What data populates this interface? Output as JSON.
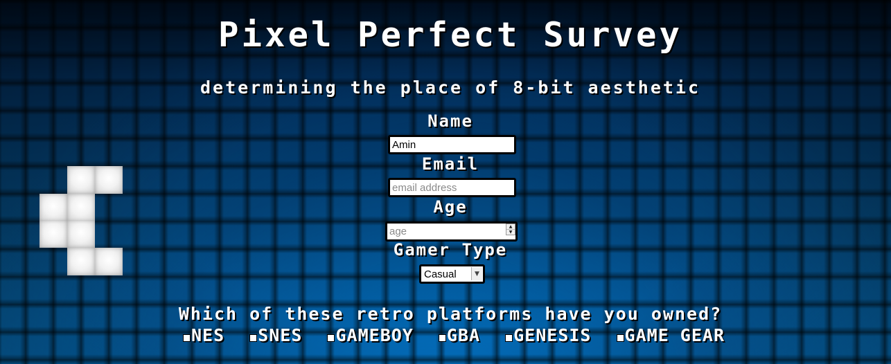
{
  "header": {
    "title": "Pixel Perfect Survey",
    "subtitle": "determining the place of 8-bit aesthetic"
  },
  "form": {
    "name": {
      "label": "Name",
      "value": "Amin",
      "placeholder": ""
    },
    "email": {
      "label": "Email",
      "value": "",
      "placeholder": "email address"
    },
    "age": {
      "label": "Age",
      "value": "",
      "placeholder": "age"
    },
    "gamer_type": {
      "label": "Gamer Type",
      "selected": "Casual"
    }
  },
  "platforms": {
    "question": "Which of these retro platforms have you owned?",
    "options": [
      {
        "label": "NES",
        "checked": false
      },
      {
        "label": "SNES",
        "checked": false
      },
      {
        "label": "GAMEBOY",
        "checked": false
      },
      {
        "label": "GBA",
        "checked": false
      },
      {
        "label": "GENESIS",
        "checked": false
      },
      {
        "label": "GAME GEAR",
        "checked": false
      }
    ]
  },
  "colors": {
    "background": "#04355f",
    "text": "#ffffff",
    "pixel_block": "#f2f2f2"
  }
}
